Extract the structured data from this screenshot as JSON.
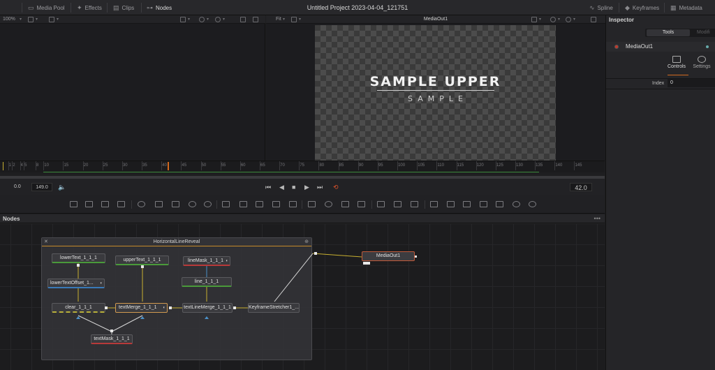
{
  "topbar": {
    "media_pool": "Media Pool",
    "effects": "Effects",
    "clips": "Clips",
    "nodes": "Nodes",
    "project_title": "Untitled Project 2023-04-04_121751",
    "spline": "Spline",
    "keyframes": "Keyframes",
    "metadata": "Metadata"
  },
  "viewer_left": {
    "zoom": "100%"
  },
  "viewer_right": {
    "fit": "Fit",
    "title": "MediaOut1"
  },
  "preview": {
    "main_text": "SAMPLE UPPER",
    "sub_text": "SAMPLE"
  },
  "inspector": {
    "title": "Inspector",
    "tab_tools": "Tools",
    "tab_modifiers": "Modifi",
    "node_name": "MediaOut1",
    "subtab_controls": "Controls",
    "subtab_settings": "Settings",
    "index_label": "Index",
    "index_value": "0"
  },
  "timeline": {
    "ticks": [
      "1",
      "2",
      "4",
      "5",
      "8",
      "10",
      "15",
      "20",
      "25",
      "30",
      "35",
      "40",
      "45",
      "50",
      "55",
      "60",
      "65",
      "70",
      "75",
      "80",
      "85",
      "90",
      "95",
      "100",
      "105",
      "110",
      "115",
      "120",
      "125",
      "130",
      "135",
      "140",
      "145"
    ],
    "start": "0.0",
    "end": "149.0",
    "current": "42.0"
  },
  "nodes_panel": {
    "title": "Nodes",
    "group_name": "HorizontalLineReveal",
    "nodes": {
      "lowerText": "lowerText_1_1_1",
      "upperText": "upperText_1_1_1",
      "lineMask": "lineMask_1_1_1",
      "lowerTextOffset": "lowerTextOffset_1...",
      "line": "line_1_1_1",
      "clear": "clear_1_1_1",
      "textMerge": "textMerge_1_1_1",
      "textLineMerge": "textLineMerge_1_1_1",
      "keyframeStretcher": "KeyframeStretcher1_...",
      "textMask": "textMask_1_1_1",
      "mediaOut": "MediaOut1"
    }
  }
}
